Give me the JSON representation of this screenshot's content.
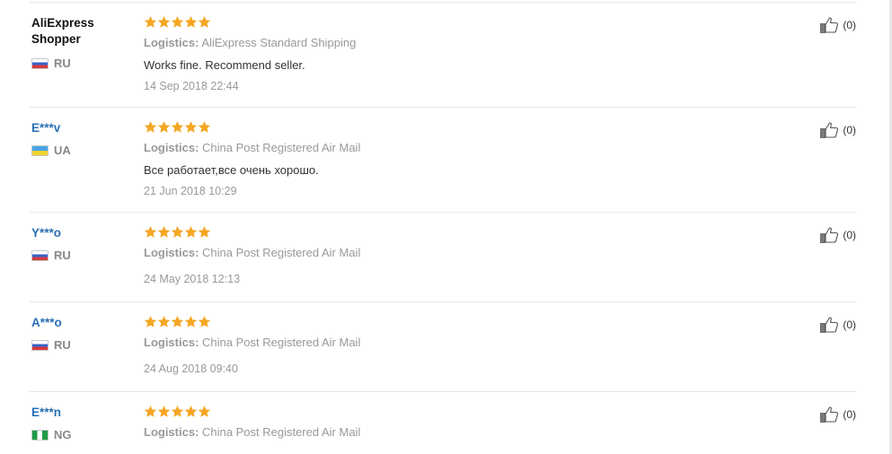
{
  "logistics_label": "Logistics:",
  "colors": {
    "star": "#f5a623",
    "user_link": "#2a6fb5",
    "muted": "#999999"
  },
  "icons": {
    "rating": "star-icon",
    "helpful": "thumbs-up-icon",
    "flag": "country-flag-icon"
  },
  "reviews": [
    {
      "user": "AliExpress Shopper",
      "country": "RU",
      "rating": 5,
      "logistics": "AliExpress Standard Shipping",
      "text": "Works fine. Recommend seller.",
      "date": "14 Sep 2018 22:44",
      "helpful": "(0)"
    },
    {
      "user": "E***v",
      "country": "UA",
      "rating": 5,
      "logistics": "China Post Registered Air Mail",
      "text": "Все работает,все очень хорошо.",
      "date": "21 Jun 2018 10:29",
      "helpful": "(0)"
    },
    {
      "user": "Y***o",
      "country": "RU",
      "rating": 5,
      "logistics": "China Post Registered Air Mail",
      "text": "",
      "date": "24 May 2018 12:13",
      "helpful": "(0)"
    },
    {
      "user": "A***o",
      "country": "RU",
      "rating": 5,
      "logistics": "China Post Registered Air Mail",
      "text": "",
      "date": "24 Aug 2018 09:40",
      "helpful": "(0)"
    },
    {
      "user": "E***n",
      "country": "NG",
      "rating": 5,
      "logistics": "China Post Registered Air Mail",
      "text": "",
      "date": "",
      "helpful": "(0)"
    }
  ]
}
